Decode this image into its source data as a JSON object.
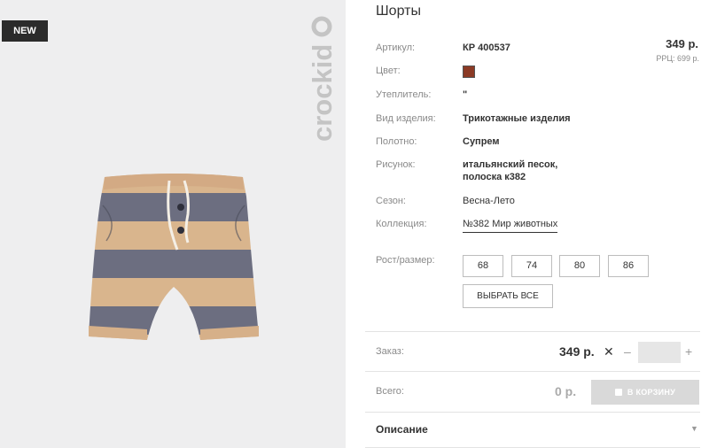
{
  "photo": {
    "badge": "NEW",
    "brand": "crockid",
    "image_alt_icon": "striped-shorts-illustration",
    "stripe_colors": [
      "#d8b38b",
      "#6b6d7f"
    ]
  },
  "product": {
    "title": "Шорты",
    "price": "349 р.",
    "rrp": "РРЦ: 699 р.",
    "swatch_color": "#8b3a25",
    "rows": {
      "article": {
        "label": "Артикул:",
        "value": "КР 400537"
      },
      "color": {
        "label": "Цвет:"
      },
      "insulation": {
        "label": "Утеплитель:",
        "value": "\""
      },
      "type": {
        "label": "Вид изделия:",
        "value": "Трикотажные изделия"
      },
      "fabric": {
        "label": "Полотно:",
        "value": "Супрем"
      },
      "pattern": {
        "label": "Рисунок:",
        "value_line1": "итальянский песок,",
        "value_line2": "полоска к382"
      },
      "season": {
        "label": "Сезон:",
        "value": "Весна-Лето"
      },
      "collection": {
        "label": "Коллекция:",
        "value": "№382 Мир животных"
      }
    },
    "sizes": {
      "label": "Рост/размер:",
      "options": [
        "68",
        "74",
        "80",
        "86"
      ],
      "select_all": "ВЫБРАТЬ ВСЕ"
    }
  },
  "order": {
    "label": "Заказ:",
    "price": "349 р.",
    "times": "✕",
    "minus": "–",
    "plus": "+",
    "quantity": ""
  },
  "total": {
    "label": "Всего:",
    "value": "0 р.",
    "cart_button": "В КОРЗИНУ"
  },
  "description": {
    "label": "Описание",
    "arrow": "▼"
  }
}
